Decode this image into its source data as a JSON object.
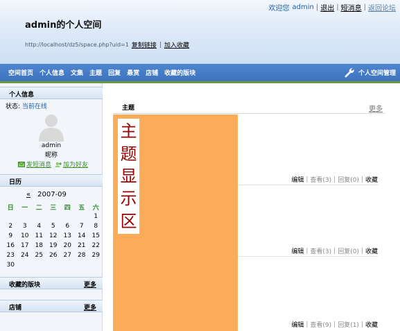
{
  "top_links": {
    "welcome": "欢迎您",
    "user": "admin",
    "logout": "退出",
    "messages": "短消息",
    "back_forum": "返回论坛"
  },
  "header": {
    "title": "admin的个人空间",
    "url": "http://localhost/dz5/space.php?uid=1",
    "copy_link": "复制链接",
    "add_favorite": "加入收藏"
  },
  "nav": {
    "items": [
      "空间首页",
      "个人信息",
      "文集",
      "主题",
      "回复",
      "悬赏",
      "店铺",
      "收藏的版块"
    ],
    "manage": "个人空间管理"
  },
  "profile": {
    "heading": "个人信息",
    "status_label": "状态:",
    "status_value": "当前在线",
    "username": "admin",
    "nickname": "昵称",
    "send_message": "发短消息",
    "add_friend": "加为好友"
  },
  "calendar": {
    "heading": "日历",
    "prev": "«",
    "month": "2007-09",
    "weekdays": [
      "日",
      "一",
      "二",
      "三",
      "四",
      "五",
      "六"
    ],
    "weeks": [
      [
        "",
        "",
        "",
        "",
        "",
        "",
        "1"
      ],
      [
        "2",
        "3",
        "4",
        "5",
        "6",
        "7",
        "8"
      ],
      [
        "9",
        "10",
        "11",
        "12",
        "13",
        "14",
        "15"
      ],
      [
        "16",
        "17",
        "18",
        "19",
        "20",
        "21",
        "22"
      ],
      [
        "23",
        "24",
        "25",
        "26",
        "27",
        "28",
        "29"
      ],
      [
        "30",
        "",
        "",
        "",
        "",
        "",
        ""
      ]
    ]
  },
  "boards": {
    "heading": "收藏的版块",
    "more": "更多"
  },
  "shop": {
    "heading": "店铺",
    "more": "更多"
  },
  "main": {
    "heading": "主题",
    "more": "更多",
    "placeholder_chars": [
      "主",
      "题",
      "显",
      "示",
      "区"
    ],
    "placeholder_bg": "#fcac58",
    "rows": [
      {
        "edit": "编辑",
        "views": "查看(3)",
        "replies": "回复(0)",
        "fav": "收藏"
      },
      {
        "edit": "编辑",
        "views": "查看(3)",
        "replies": "回复(0)",
        "fav": "收藏"
      },
      {
        "edit": "编辑",
        "views": "查看(9)",
        "replies": "回复(1)",
        "fav": "收藏"
      }
    ]
  },
  "colors": {
    "nav_bg": "#4f86cf",
    "accent_green": "#6a9a3c",
    "link_blue": "#1f5fa6"
  },
  "icons": {
    "manage": "wrench-icon",
    "message": "envelope-icon",
    "friend": "add-friend-icon",
    "avatar": "user-silhouette-icon"
  }
}
